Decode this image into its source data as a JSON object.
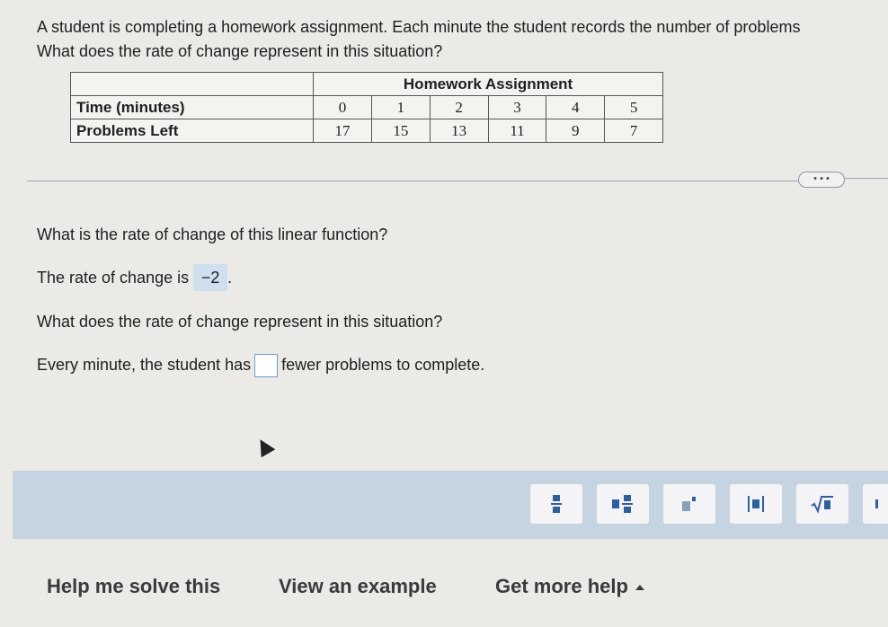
{
  "problem": {
    "line1": "A student is completing a homework assignment. Each minute the student records the number of problems",
    "line2": "What does the rate of change represent in this situation?"
  },
  "table": {
    "title": "Homework Assignment",
    "rows": [
      {
        "label": "Time (minutes)",
        "values": [
          "0",
          "1",
          "2",
          "3",
          "4",
          "5"
        ]
      },
      {
        "label": "Problems Left",
        "values": [
          "17",
          "15",
          "13",
          "11",
          "9",
          "7"
        ]
      }
    ]
  },
  "more_button": "• • •",
  "questions": {
    "q1": "What is the rate of change of this linear function?",
    "q2_prefix": "The rate of change is",
    "q2_answer": "−2",
    "q2_suffix": ".",
    "q3": "What does the rate of change represent in this situation?",
    "q4_prefix": "Every minute, the student has",
    "q4_suffix": "fewer problems to complete."
  },
  "toolbar": {
    "tools": [
      "fraction-icon",
      "mixed-number-icon",
      "exponent-icon",
      "absolute-value-icon",
      "square-root-icon"
    ]
  },
  "help": {
    "help_me": "Help me solve this",
    "example": "View an example",
    "more": "Get more help"
  }
}
